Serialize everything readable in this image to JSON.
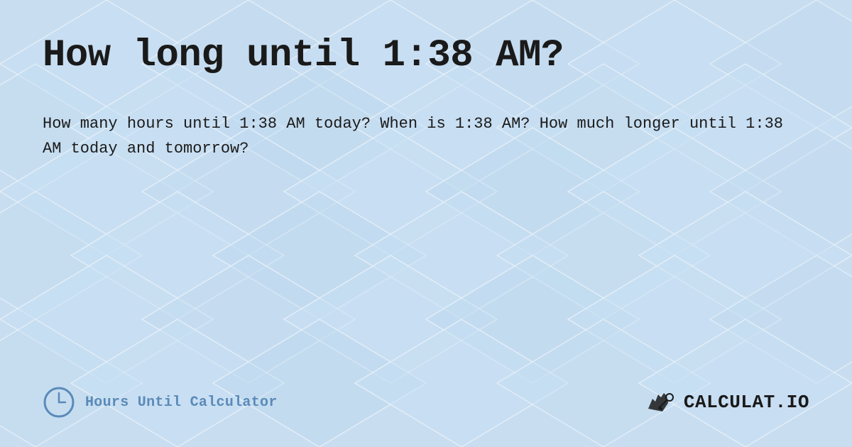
{
  "page": {
    "title": "How long until 1:38 AM?",
    "description": "How many hours until 1:38 AM today? When is 1:38 AM? How much longer until 1:38 AM today and tomorrow?",
    "brand_left_label": "Hours Until Calculator",
    "brand_right_label": "CALCULAT.IO",
    "background_color": "#c8ddf0",
    "text_color": "#1a1a1a",
    "accent_color": "#5a8ab8"
  }
}
